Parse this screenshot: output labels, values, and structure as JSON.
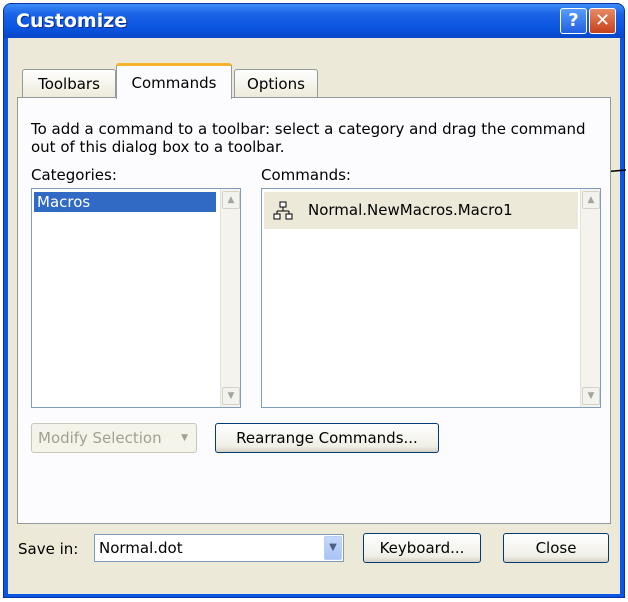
{
  "window": {
    "title": "Customize"
  },
  "title_buttons": {
    "help": "?",
    "close": "✕"
  },
  "tabs": [
    {
      "label": "Toolbars",
      "active": false
    },
    {
      "label": "Commands",
      "active": true
    },
    {
      "label": "Options",
      "active": false
    }
  ],
  "description": "To add a command to a toolbar: select a category and drag the command out of this dialog box to a toolbar.",
  "categories": {
    "label": "Categories:",
    "items": [
      "Macros"
    ],
    "selected": "Macros"
  },
  "commands": {
    "label": "Commands:",
    "items": [
      {
        "icon": "macro-icon",
        "label": "Normal.NewMacros.Macro1"
      }
    ]
  },
  "buttons": {
    "modify_selection": "Modify Selection",
    "rearrange_commands": "Rearrange Commands...",
    "keyboard": "Keyboard...",
    "close": "Close"
  },
  "save_in": {
    "label": "Save in:",
    "value": "Normal.dot"
  },
  "colors": {
    "title_bar": "#0a55e0",
    "dialog_bg": "#ece9d8",
    "selection": "#316ac5",
    "tab_highlight": "#f7b22c"
  }
}
